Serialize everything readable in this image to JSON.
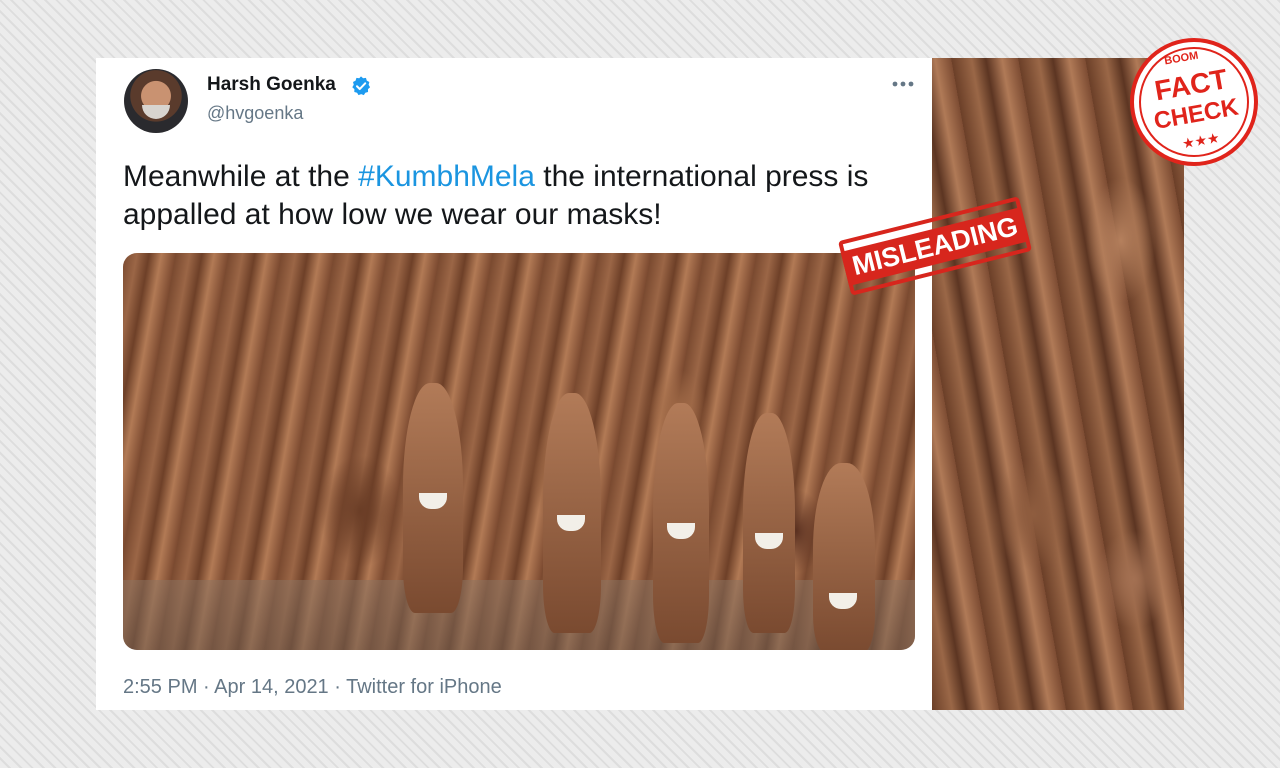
{
  "tweet": {
    "author_name": "Harsh Goenka",
    "author_handle": "@hvgoenka",
    "verified_icon": "verified-badge-icon",
    "more_icon": "more-options-icon",
    "text_before": "Meanwhile at the ",
    "hashtag": "#KumbhMela",
    "text_after": " the international press is appalled at how low we wear our masks!",
    "timestamp": "2:55 PM · Apr 14, 2021 · Twitter for iPhone",
    "hashtag_color": "#1b95e0"
  },
  "overlays": {
    "misleading_label": "MISLEADING",
    "fact_check": {
      "top": "BOOM",
      "line1": "FACT",
      "line2": "CHECK",
      "stars": "★★★",
      "color": "#e0241b"
    }
  }
}
